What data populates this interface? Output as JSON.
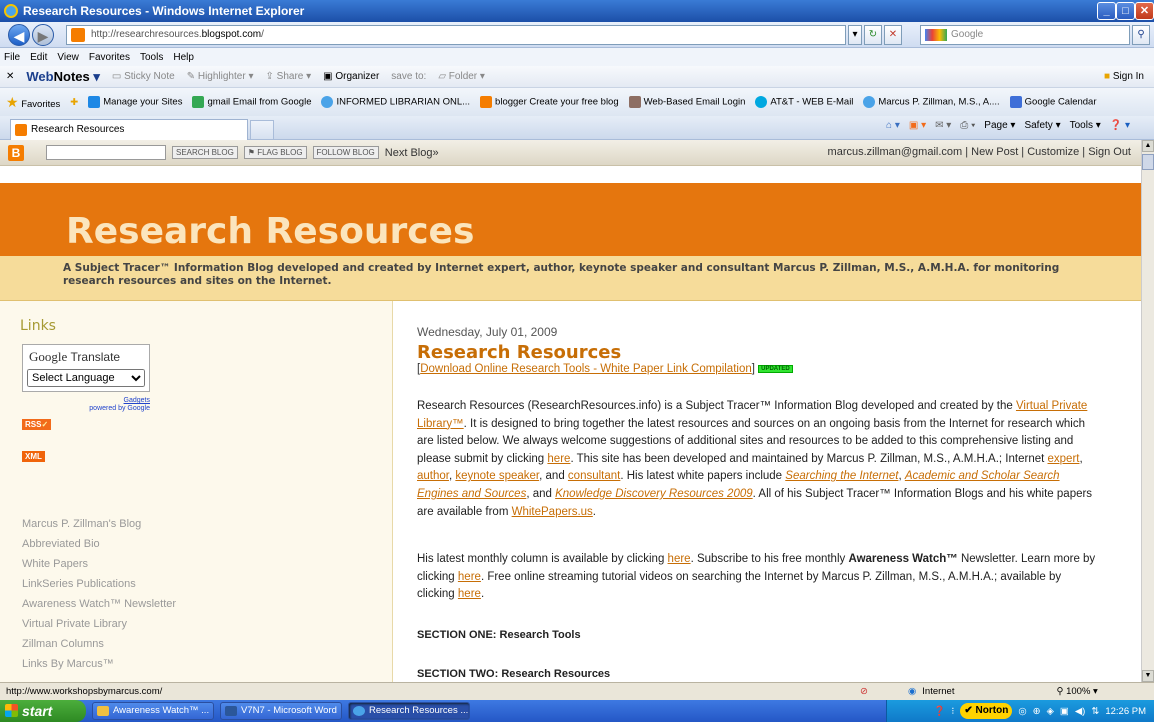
{
  "window": {
    "title": "Research Resources - Windows Internet Explorer",
    "controls": [
      "_",
      "□",
      "✕"
    ]
  },
  "address": {
    "url_prefix": "http://researchresources.",
    "url_domain": "blogspot.com",
    "url_suffix": "/",
    "search_placeholder": "Google"
  },
  "menu": [
    "File",
    "Edit",
    "View",
    "Favorites",
    "Tools",
    "Help"
  ],
  "webnotes": {
    "brand_web": "Web",
    "brand_notes": "Notes",
    "items": [
      "Sticky Note",
      "Highlighter",
      "Share",
      "Organizer",
      "save to:",
      "Folder"
    ],
    "sign_in": "Sign In"
  },
  "favorites": {
    "label": "Favorites",
    "items": [
      {
        "label": "Manage your Sites",
        "icon": "sites-icon",
        "color": "#1e88e5"
      },
      {
        "label": "gmail Email from Google",
        "icon": "google-icon",
        "color": "#34a853"
      },
      {
        "label": "INFORMED LIBRARIAN ONL...",
        "icon": "ie-page-icon",
        "color": "#4aa3e8"
      },
      {
        "label": "blogger Create your free blog",
        "icon": "blogger-icon",
        "color": "#f57d00"
      },
      {
        "label": "Web-Based Email Login",
        "icon": "email-icon",
        "color": "#8d6e63"
      },
      {
        "label": "AT&T - WEB E-Mail",
        "icon": "att-icon",
        "color": "#00a8e0"
      },
      {
        "label": "Marcus P. Zillman, M.S., A....",
        "icon": "ie-page-icon",
        "color": "#4aa3e8"
      },
      {
        "label": "Google Calendar",
        "icon": "calendar-icon",
        "color": "#3f6fd8"
      }
    ]
  },
  "tab": {
    "label": "Research Resources"
  },
  "commands": [
    "Page ▾",
    "Safety ▾",
    "Tools ▾"
  ],
  "blognav": {
    "search_blog": "SEARCH BLOG",
    "flag_blog": "⚑ FLAG BLOG",
    "follow_blog": "FOLLOW BLOG",
    "next_blog": "Next Blog»",
    "email": "marcus.zillman@gmail.com",
    "new_post": "New Post",
    "customize": "Customize",
    "sign_out": "Sign Out"
  },
  "blog": {
    "title": "Research Resources",
    "description": "A Subject Tracer™ Information Blog developed and created by Internet expert, author, keynote speaker and consultant Marcus P. Zillman, M.S., A.M.H.A. for monitoring research resources and sites on the Internet."
  },
  "sidebar": {
    "links_heading": "Links",
    "translate_brand": "Google",
    "translate_label": "Translate",
    "select_language": "Select Language",
    "gadgets": "Gadgets",
    "powered_by": "powered by Google",
    "rss": "RSS",
    "xml": "XML",
    "links": [
      "Marcus P. Zillman's Blog",
      "Abbreviated Bio",
      "White Papers",
      "LinkSeries Publications",
      "Awareness Watch™ Newsletter",
      "Virtual Private Library",
      "Zillman Columns",
      "Links By Marcus™"
    ]
  },
  "post": {
    "date": "Wednesday, July 01, 2009",
    "title": "Research Resources",
    "download_link": "Download Online Research Tools - White Paper Link Compilation",
    "updated_badge": "UPDATED",
    "p1": {
      "t1": "Research Resources (ResearchResources.info) is a Subject Tracer™ Information Blog developed and created by the ",
      "vpl": "Virtual Private Library™",
      "t2": ". It is designed to bring together the latest resources and sources on an ongoing basis from the Internet for research which are listed below. We always welcome suggestions of additional sites and resources to be added to this comprehensive listing and please submit by clicking ",
      "here": "here",
      "t3": ". This site has been developed and maintained by Marcus P. Zillman, M.S., A.M.H.A.; Internet ",
      "expert": "expert",
      "c1": ", ",
      "author": "author",
      "c2": ", ",
      "keynote": "keynote speaker",
      "c3": ", and ",
      "consultant": "consultant",
      "t4": ". His latest white papers include ",
      "searching": "Searching the Internet",
      "c4": ", ",
      "academic": "Academic and Scholar Search Engines and Sources",
      "c5": ", and ",
      "knowledge": "Knowledge Discovery Resources 2009",
      "t5": ". All of his Subject Tracer™ Information Blogs and his white papers are available from ",
      "whitepapers": "WhitePapers.us",
      "t6": "."
    },
    "p2": {
      "t1": "His latest monthly column is available by clicking ",
      "here1": "here",
      "t2": ". Subscribe to his free monthly ",
      "aw": "Awareness Watch™",
      "t3": " Newsletter. Learn more by clicking ",
      "here2": "here",
      "t4": ". Free online streaming tutorial videos on searching the Internet by Marcus P. Zillman, M.S., A.M.H.A.; available by clicking ",
      "here3": "here",
      "t5": "."
    },
    "section1": "SECTION ONE: Research Tools",
    "section2": "SECTION TWO: Research Resources"
  },
  "status": {
    "url": "http://www.workshopsbymarcus.com/",
    "zone": "Internet",
    "zoom": "100%"
  },
  "taskbar": {
    "start": "start",
    "tasks": [
      {
        "label": "Awareness Watch™ ...",
        "icon": "folder-icon",
        "color": "#f0c040"
      },
      {
        "label": "V7N7 - Microsoft Word",
        "icon": "word-icon",
        "color": "#2b579a"
      },
      {
        "label": "Research Resources ...",
        "icon": "ie-icon",
        "color": "#4aa3e8"
      }
    ],
    "norton": "Norton",
    "clock": "12:26 PM"
  }
}
